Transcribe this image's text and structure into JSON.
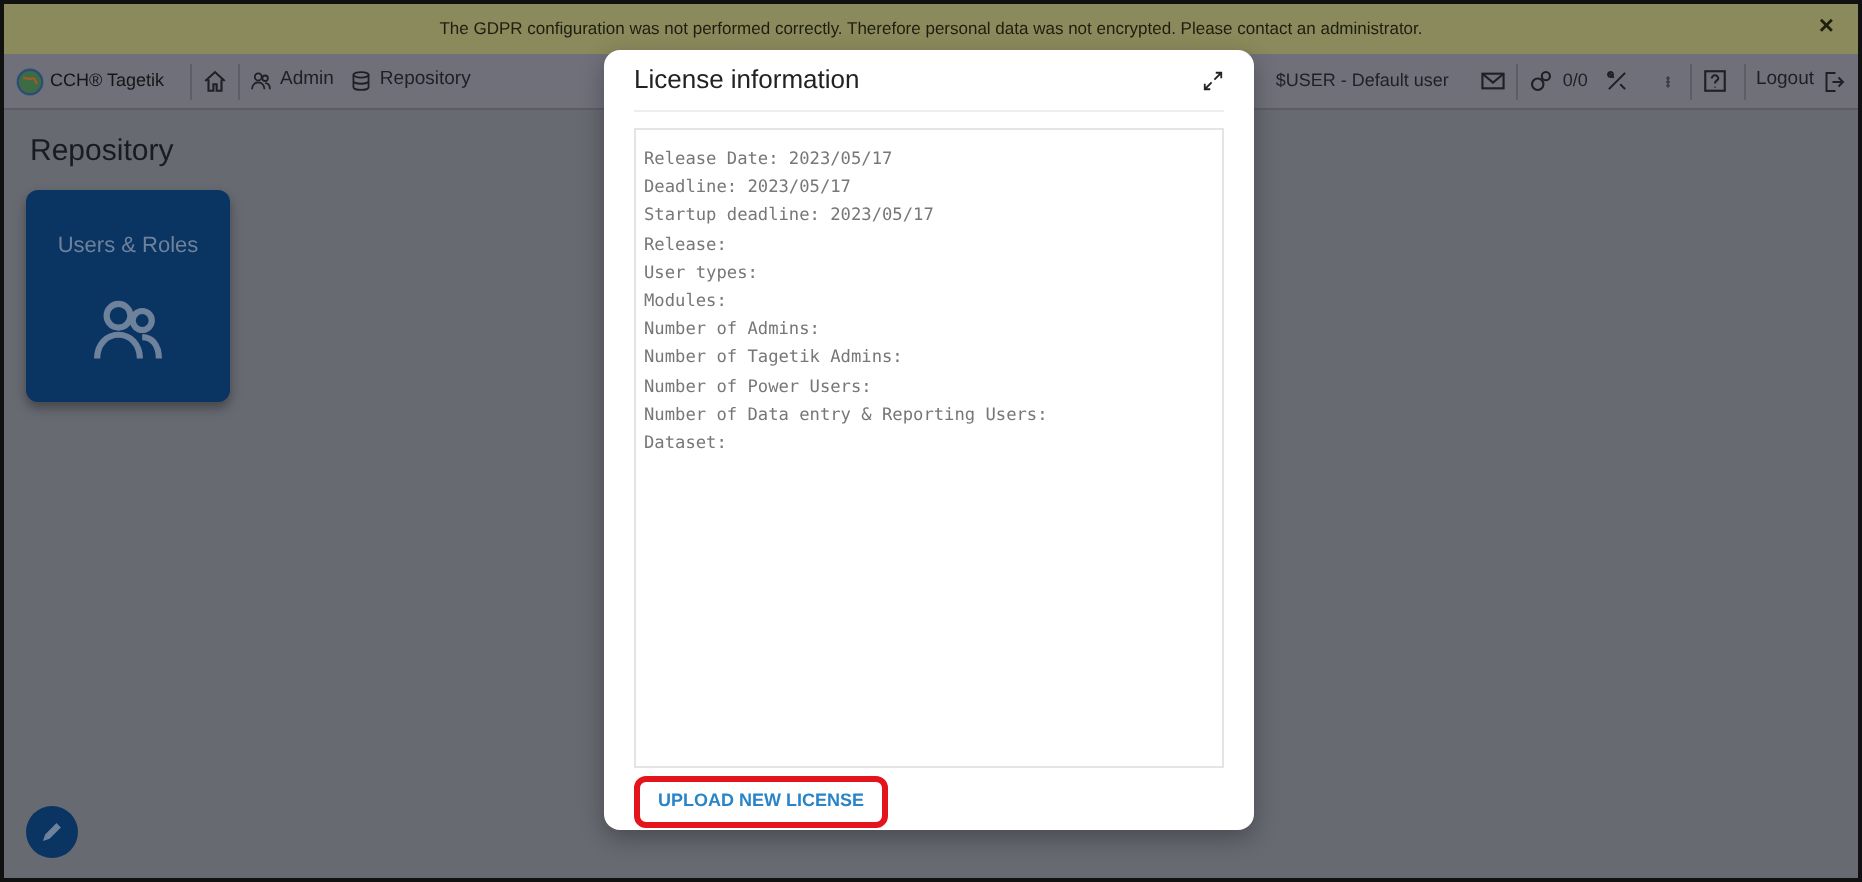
{
  "banner": {
    "message": "The GDPR configuration was not performed correctly. Therefore personal data was not encrypted. Please contact an administrator.",
    "close": "×"
  },
  "navbar": {
    "brand": "CCH® Tagetik",
    "breadcrumbs": [
      {
        "label": "Admin"
      },
      {
        "label": "Repository"
      }
    ],
    "user": "$USER - Default user",
    "tasks": "0/0",
    "logout": "Logout"
  },
  "page": {
    "title": "Repository",
    "tiles": [
      {
        "label": "Users & Roles"
      }
    ]
  },
  "modal": {
    "title": "License information",
    "lines": [
      "Release Date: 2023/05/17",
      "Deadline: 2023/05/17",
      "Startup deadline: 2023/05/17",
      "Release:",
      "User types:",
      "Modules:",
      "Number of Admins:",
      "Number of Tagetik Admins:",
      "Number of Power Users:",
      "Number of Data entry & Reporting Users:",
      "Dataset:"
    ],
    "action": {
      "label": "UPLOAD NEW LICENSE",
      "highlighted": true
    }
  }
}
